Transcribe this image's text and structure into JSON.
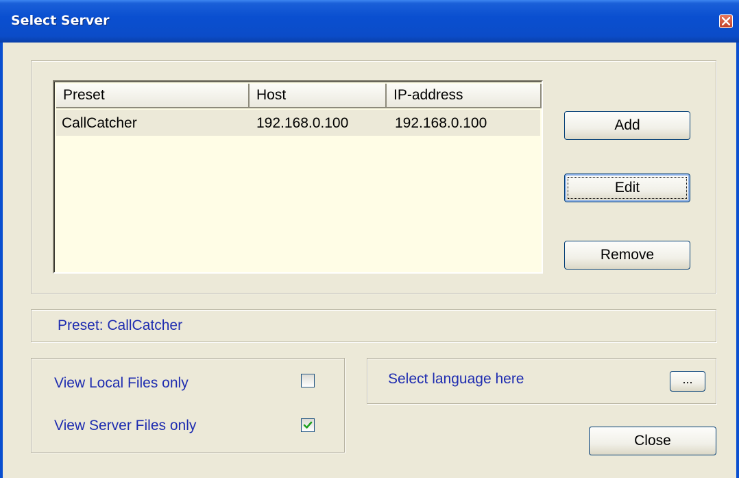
{
  "window": {
    "title": "Select Server"
  },
  "list": {
    "columns": [
      "Preset",
      "Host",
      "IP-address"
    ],
    "rows": [
      {
        "preset": "CallCatcher",
        "host": "192.168.0.100",
        "ip": "192.168.0.100"
      }
    ]
  },
  "buttons": {
    "add": "Add",
    "edit": "Edit",
    "remove": "Remove",
    "close": "Close",
    "browse": "..."
  },
  "preset_text": "Preset:  CallCatcher",
  "options": {
    "local_label": "View Local Files only",
    "local_checked": false,
    "server_label": "View Server Files only",
    "server_checked": true
  },
  "language_label": "Select language here",
  "colors": {
    "label_blue": "#1e2cb0",
    "titlebar_blue": "#0a4fd0",
    "list_bg": "#fffde6"
  }
}
